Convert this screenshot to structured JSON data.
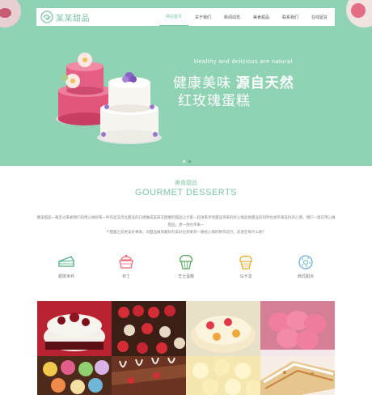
{
  "brand": {
    "name": "某某甜品",
    "accent": "#7cc6a4",
    "hero_bg": "#8fd3b4"
  },
  "nav": {
    "items": [
      {
        "label": "网站首页",
        "active": true
      },
      {
        "label": "关于我们",
        "active": false
      },
      {
        "label": "新闻动态",
        "active": false
      },
      {
        "label": "美食甜品",
        "active": false
      },
      {
        "label": "联系我们",
        "active": false
      },
      {
        "label": "在线留言",
        "active": false
      }
    ]
  },
  "hero": {
    "slogan_en": "Healthy and delicious are natural",
    "slogan_line1_a": "健康美味",
    "slogan_line1_b": "源自天然",
    "slogan_line2": "红玫瑰蛋糕",
    "slides": 2,
    "active_slide": 2
  },
  "section": {
    "title_cn": "美食甜品",
    "title_en": "GOURMET DESSERTS"
  },
  "intro": {
    "line1": "健美甜品一路走过来被我们的用心做好每一件作品又优化甜品的口感做成美味又健康的甜品让大家一起进来享受甜品带来的好心情品尝甜品的同时也会带来美好的心情，我们一直在用心做甜品。想一想也带来一",
    "line2": "个甜蜜之前更美好事来，对甜品做到最好的美好也到来到一路给心情的制作前行，前进在每什么呢？"
  },
  "categories": [
    {
      "label": "甜饼米乔",
      "icon": "cake-slice-icon"
    },
    {
      "label": "布丁",
      "icon": "pudding-icon"
    },
    {
      "label": "芝士蛋糕",
      "icon": "cupcake-icon"
    },
    {
      "label": "马卡龙",
      "icon": "macaron-icon"
    },
    {
      "label": "西式甜点",
      "icon": "donut-icon"
    }
  ]
}
